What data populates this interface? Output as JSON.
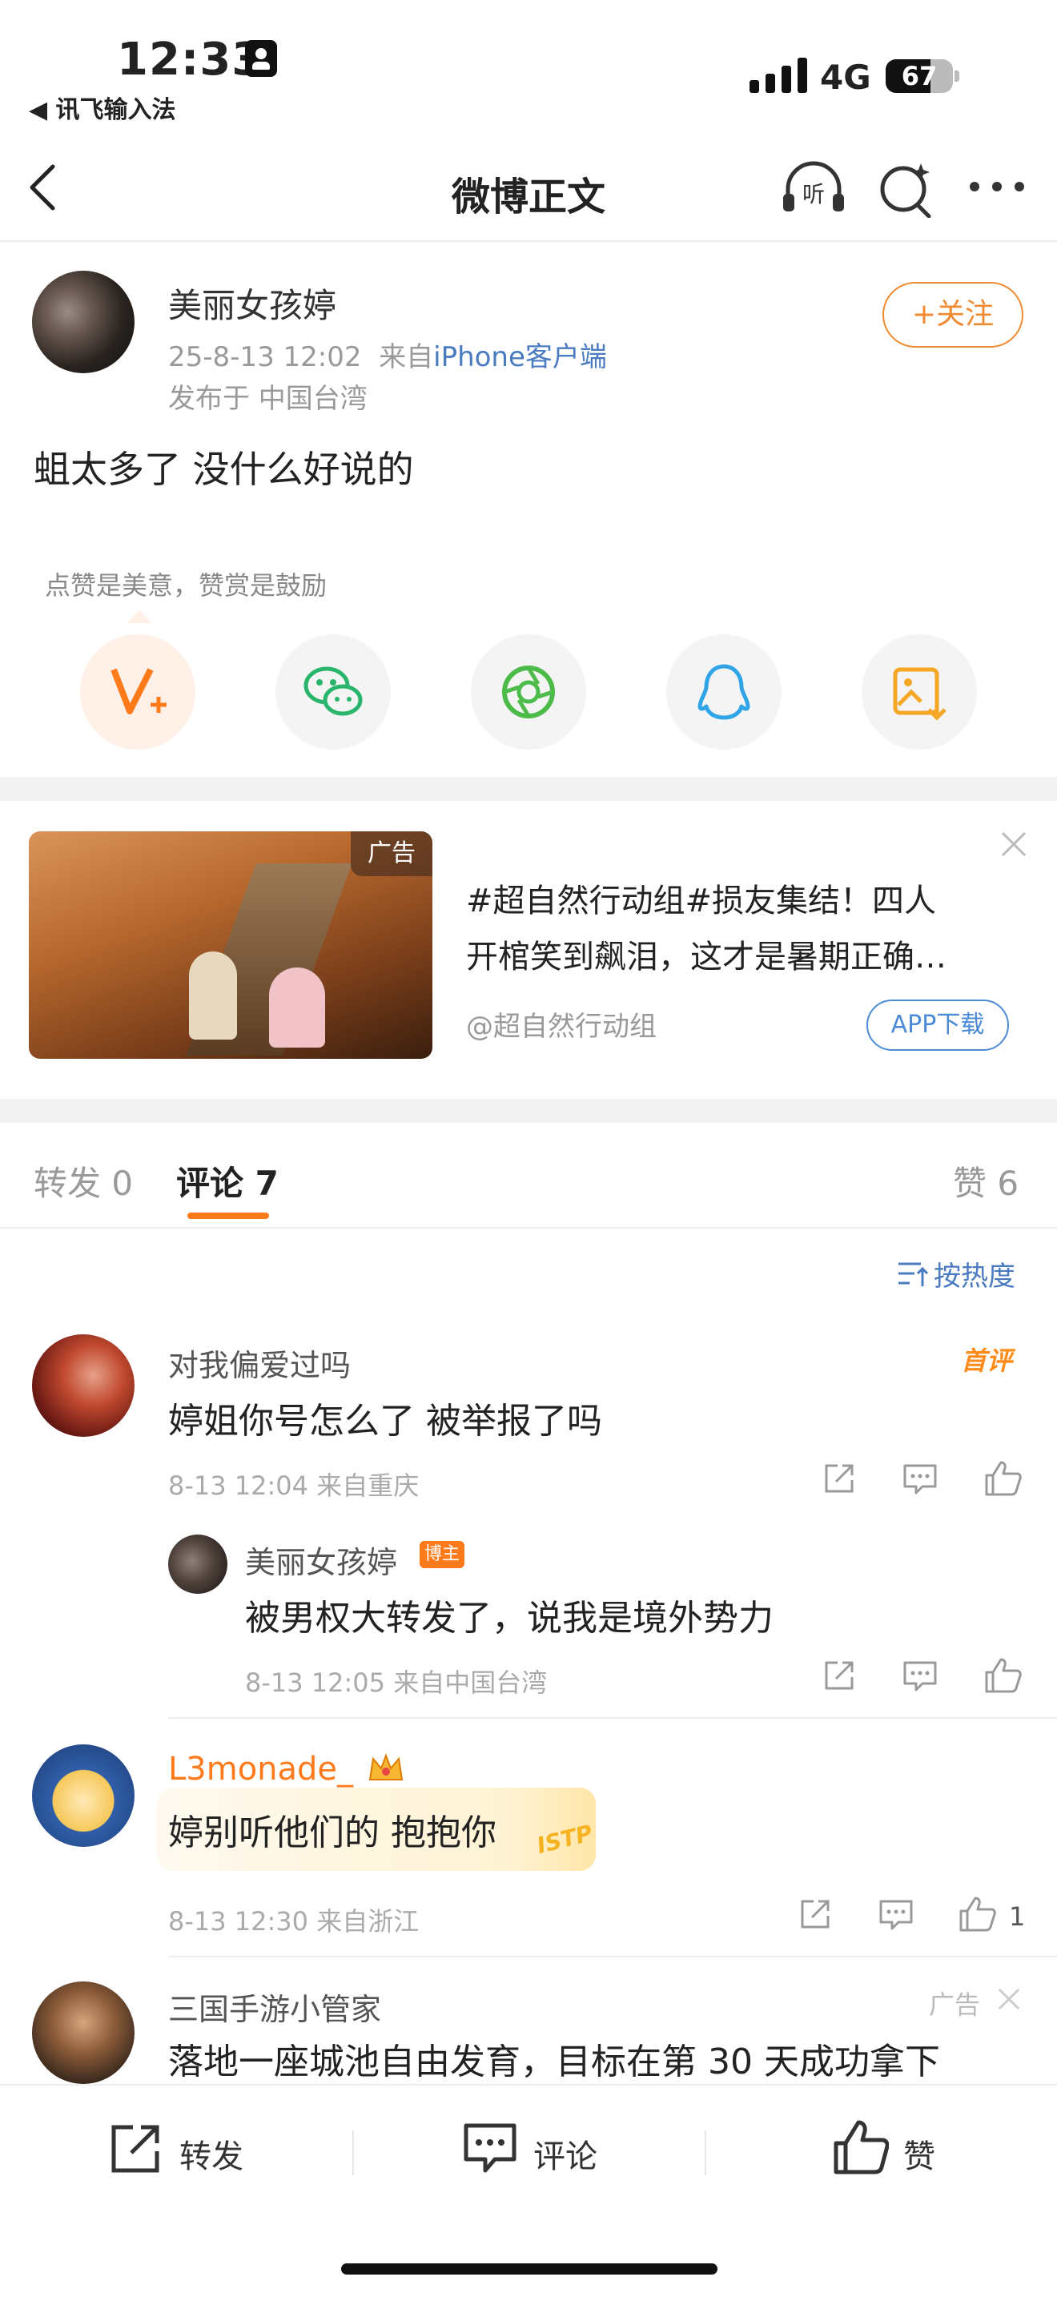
{
  "status_bar": {
    "time": "12:33",
    "back_app": "◀ 讯飞输入法",
    "network": "4G",
    "battery": "67",
    "battery_level": 0.67
  },
  "nav": {
    "title": "微博正文",
    "listen_icon": "headphones-listen-icon",
    "refresh_icon": "sparkle-search-icon",
    "more_icon": "more-dots-icon"
  },
  "post": {
    "author": "美丽女孩婷",
    "date": "25-8-13 12:02",
    "source_prefix": "来自",
    "source": "iPhone客户端",
    "location": "发布于 中国台湾",
    "follow_label": "+关注",
    "text": "蛆太多了 没什么好说的"
  },
  "tip": {
    "hint": "点赞是美意，赞赏是鼓励"
  },
  "share_icons": [
    "tip-v-plus-icon",
    "wechat-icon",
    "moments-icon",
    "qq-icon",
    "save-image-icon"
  ],
  "ad": {
    "badge": "广告",
    "title_line1": "#超自然行动组#损友集结！四人",
    "title_line2": "开棺笑到飙泪，这才是暑期正确…",
    "source": "@超自然行动组",
    "button": "APP下载"
  },
  "tabs": {
    "repost": "转发 0",
    "comment": "评论 7",
    "like": "赞 6"
  },
  "sort": {
    "label": "按热度"
  },
  "comments": [
    {
      "name": "对我偏爱过吗",
      "badge": "首评",
      "text": "婷姐你号怎么了 被举报了吗",
      "meta": "8-13 12:04  来自重庆",
      "reply": {
        "name": "美丽女孩婷",
        "tag": "博主",
        "text": "被男权大转发了，说我是境外势力",
        "meta": "8-13 12:05  来自中国台湾"
      }
    },
    {
      "name": "L3monade_",
      "text": "婷别听他们的 抱抱你",
      "sticker": "ISTP",
      "meta": "8-13 12:30  来自浙江",
      "likes": "1"
    },
    {
      "name": "三国手游小管家",
      "ad": "广告",
      "text": "落地一座城池自由发育，目标在第 30 天成功拿下"
    }
  ],
  "bottom": {
    "repost": "转发",
    "comment": "评论",
    "like": "赞"
  },
  "colors": {
    "accent": "#ff7a1a",
    "link": "#4a7bc1"
  }
}
